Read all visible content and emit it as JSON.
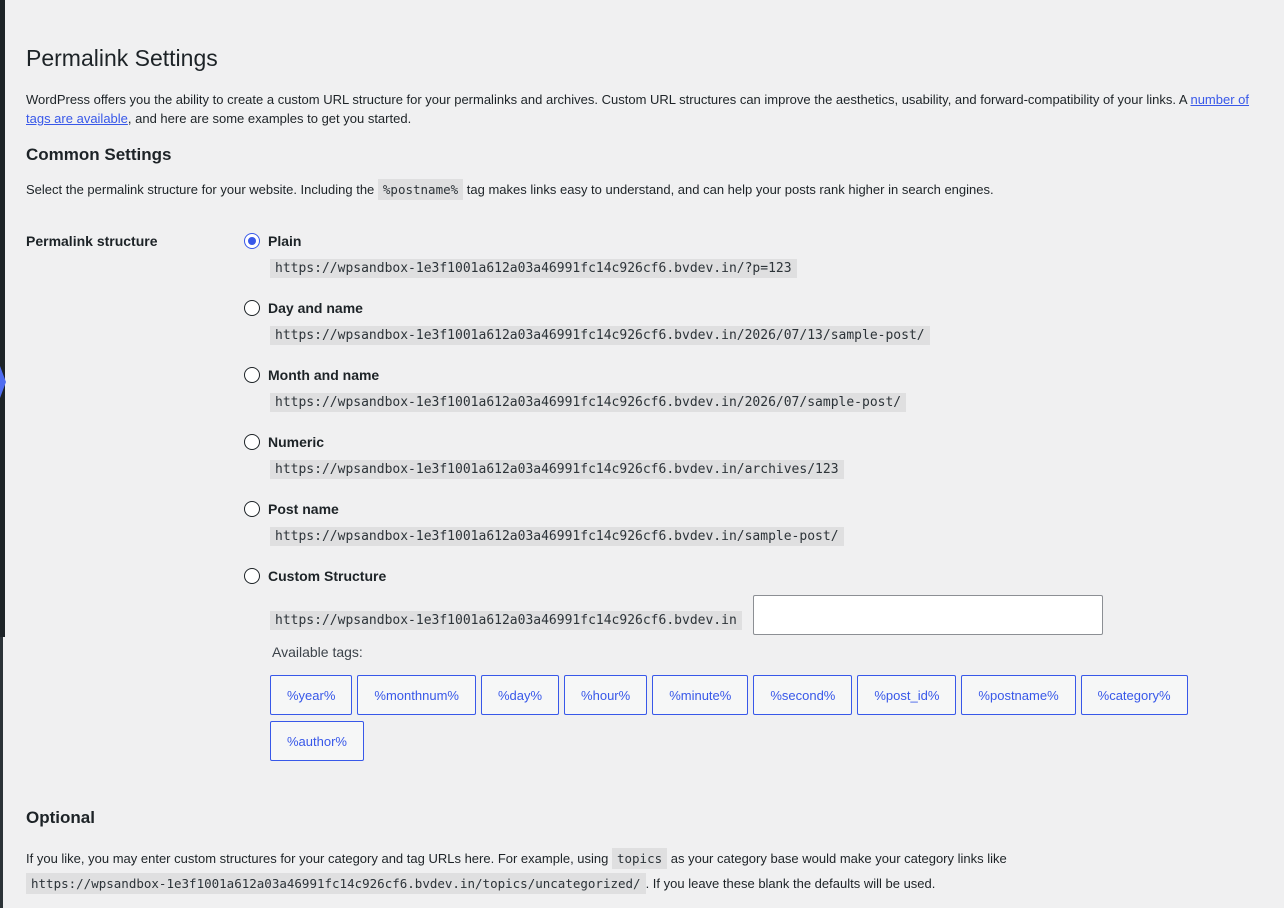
{
  "page": {
    "title": "Permalink Settings",
    "intro_before": "WordPress offers you the ability to create a custom URL structure for your permalinks and archives. Custom URL structures can improve the aesthetics, usability, and forward-compatibility of your links. A ",
    "intro_link": "number of tags are available",
    "intro_after": ", and here are some examples to get you started."
  },
  "common": {
    "heading": "Common Settings",
    "desc_before": "Select the permalink structure for your website. Including the ",
    "desc_code": "%postname%",
    "desc_after": " tag makes links easy to understand, and can help your posts rank higher in search engines.",
    "field_label": "Permalink structure"
  },
  "options": [
    {
      "label": "Plain",
      "url": "https://wpsandbox-1e3f1001a612a03a46991fc14c926cf6.bvdev.in/?p=123",
      "checked": true
    },
    {
      "label": "Day and name",
      "url": "https://wpsandbox-1e3f1001a612a03a46991fc14c926cf6.bvdev.in/2026/07/13/sample-post/",
      "checked": false
    },
    {
      "label": "Month and name",
      "url": "https://wpsandbox-1e3f1001a612a03a46991fc14c926cf6.bvdev.in/2026/07/sample-post/",
      "checked": false
    },
    {
      "label": "Numeric",
      "url": "https://wpsandbox-1e3f1001a612a03a46991fc14c926cf6.bvdev.in/archives/123",
      "checked": false
    },
    {
      "label": "Post name",
      "url": "https://wpsandbox-1e3f1001a612a03a46991fc14c926cf6.bvdev.in/sample-post/",
      "checked": false
    },
    {
      "label": "Custom Structure",
      "url": "https://wpsandbox-1e3f1001a612a03a46991fc14c926cf6.bvdev.in",
      "checked": false
    }
  ],
  "custom": {
    "value": "",
    "available_tags_label": "Available tags:",
    "tags": [
      "%year%",
      "%monthnum%",
      "%day%",
      "%hour%",
      "%minute%",
      "%second%",
      "%post_id%",
      "%postname%",
      "%category%",
      "%author%"
    ]
  },
  "optional": {
    "heading": "Optional",
    "desc_before": "If you like, you may enter custom structures for your category and tag URLs here. For example, using ",
    "desc_code": "topics",
    "desc_middle": " as your category base would make your category links like",
    "example_url": "https://wpsandbox-1e3f1001a612a03a46991fc14c926cf6.bvdev.in/topics/uncategorized/",
    "desc_after": ". If you leave these blank the defaults will be used."
  },
  "colors": {
    "accent": "#3858e9",
    "background": "#f0f0f1",
    "text": "#1d2327"
  }
}
